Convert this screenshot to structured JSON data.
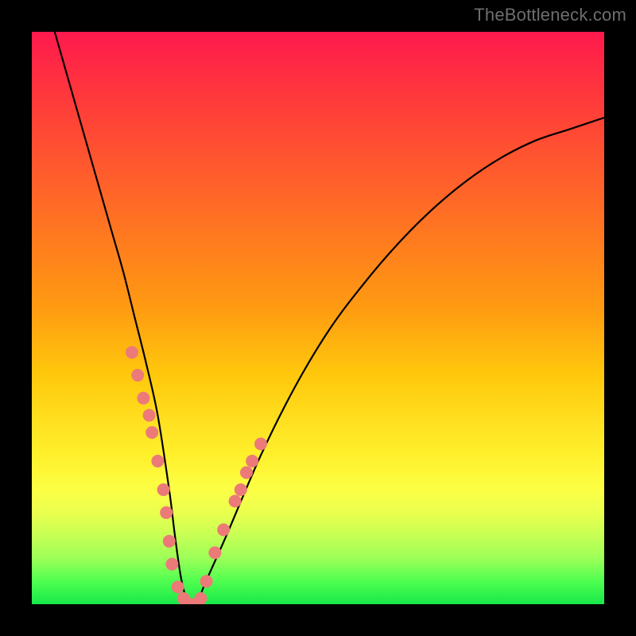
{
  "watermark": "TheBottleneck.com",
  "chart_data": {
    "type": "line",
    "title": "",
    "xlabel": "",
    "ylabel": "",
    "xlim": [
      0,
      100
    ],
    "ylim": [
      0,
      100
    ],
    "grid": false,
    "legend": false,
    "series": [
      {
        "name": "curve",
        "color": "#000000",
        "x": [
          4,
          6,
          8,
          10,
          12,
          14,
          16,
          18,
          20,
          22,
          24,
          25,
          26,
          27,
          28,
          29,
          30,
          34,
          40,
          46,
          52,
          58,
          64,
          70,
          76,
          82,
          88,
          94,
          100
        ],
        "y": [
          100,
          93,
          86,
          79,
          72,
          65,
          58,
          50,
          42,
          33,
          20,
          12,
          5,
          1,
          0,
          0,
          3,
          12,
          26,
          38,
          48,
          56,
          63,
          69,
          74,
          78,
          81,
          83,
          85
        ]
      }
    ],
    "markers": [
      {
        "name": "dots",
        "color": "#ec7a78",
        "radius": 8,
        "points": [
          {
            "x": 17.5,
            "y": 44
          },
          {
            "x": 18.5,
            "y": 40
          },
          {
            "x": 19.5,
            "y": 36
          },
          {
            "x": 20.5,
            "y": 33
          },
          {
            "x": 21.0,
            "y": 30
          },
          {
            "x": 22.0,
            "y": 25
          },
          {
            "x": 23.0,
            "y": 20
          },
          {
            "x": 23.5,
            "y": 16
          },
          {
            "x": 24.0,
            "y": 11
          },
          {
            "x": 24.5,
            "y": 7
          },
          {
            "x": 25.5,
            "y": 3
          },
          {
            "x": 26.5,
            "y": 1
          },
          {
            "x": 27.5,
            "y": 0
          },
          {
            "x": 28.5,
            "y": 0
          },
          {
            "x": 29.5,
            "y": 1
          },
          {
            "x": 30.5,
            "y": 4
          },
          {
            "x": 32.0,
            "y": 9
          },
          {
            "x": 33.5,
            "y": 13
          },
          {
            "x": 35.5,
            "y": 18
          },
          {
            "x": 36.5,
            "y": 20
          },
          {
            "x": 37.5,
            "y": 23
          },
          {
            "x": 38.5,
            "y": 25
          },
          {
            "x": 40.0,
            "y": 28
          }
        ]
      }
    ]
  }
}
